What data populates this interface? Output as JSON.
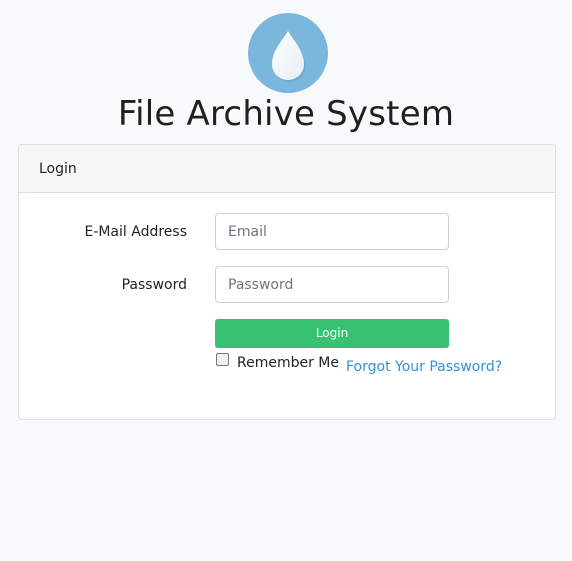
{
  "app": {
    "title": "File Archive System",
    "logo_icon": "water-drop-icon",
    "logo_color": "#7bb7dc"
  },
  "login_card": {
    "header": "Login",
    "email": {
      "label": "E-Mail Address",
      "placeholder": "Email",
      "value": ""
    },
    "password": {
      "label": "Password",
      "placeholder": "Password",
      "value": ""
    },
    "submit_label": "Login",
    "remember_label": "Remember Me",
    "remember_checked": false,
    "forgot_label": "Forgot Your Password?"
  },
  "colors": {
    "accent_green": "#38c172",
    "link_blue": "#3490dc",
    "background": "#f8f9fb"
  }
}
